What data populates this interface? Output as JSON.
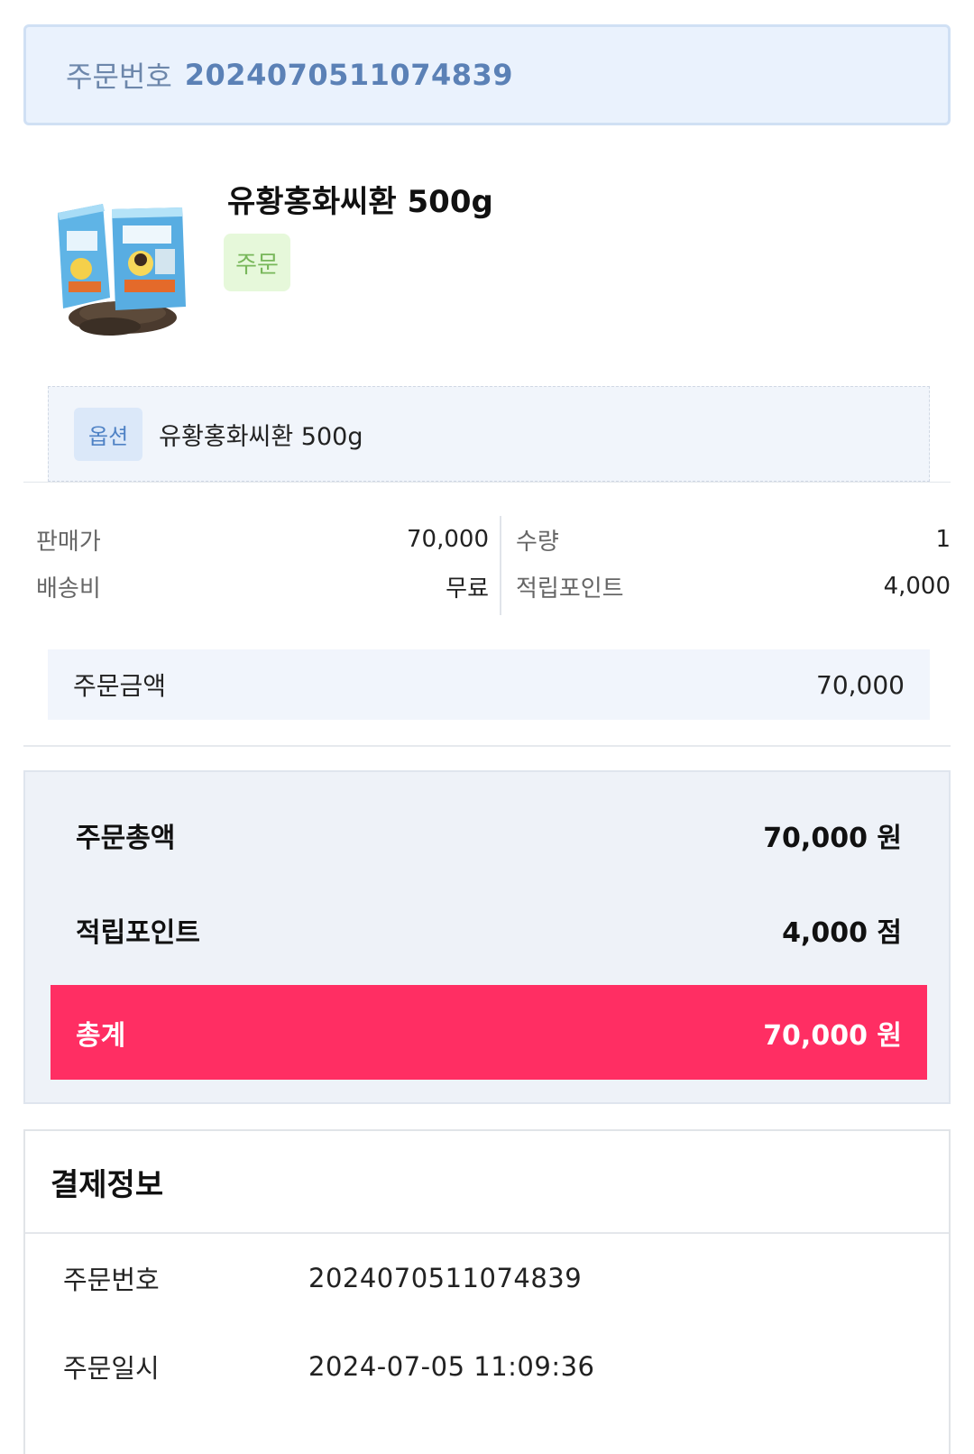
{
  "order_header": {
    "label": "주문번호",
    "number": "2024070511074839"
  },
  "product": {
    "name": "유황홍화씨환 500g",
    "status": "주문",
    "option_tag": "옵션",
    "option_text": "유황홍화씨환 500g",
    "thumb_icon": "product-image"
  },
  "price_info": {
    "sale_price_label": "판매가",
    "sale_price": "70,000",
    "shipping_label": "배송비",
    "shipping": "무료",
    "quantity_label": "수량",
    "quantity": "1",
    "points_label": "적립포인트",
    "points": "4,000"
  },
  "order_amount": {
    "label": "주문금액",
    "value": "70,000"
  },
  "summary": {
    "order_total_label": "주문총액",
    "order_total": "70,000 원",
    "points_label": "적립포인트",
    "points": "4,000 점",
    "grand_total_label": "총계",
    "grand_total": "70,000 원",
    "accent_color": "#ff2e63"
  },
  "payment": {
    "title": "결제정보",
    "rows": [
      {
        "label": "주문번호",
        "value": "2024070511074839"
      },
      {
        "label": "주문일시",
        "value": "2024-07-05 11:09:36"
      }
    ]
  }
}
